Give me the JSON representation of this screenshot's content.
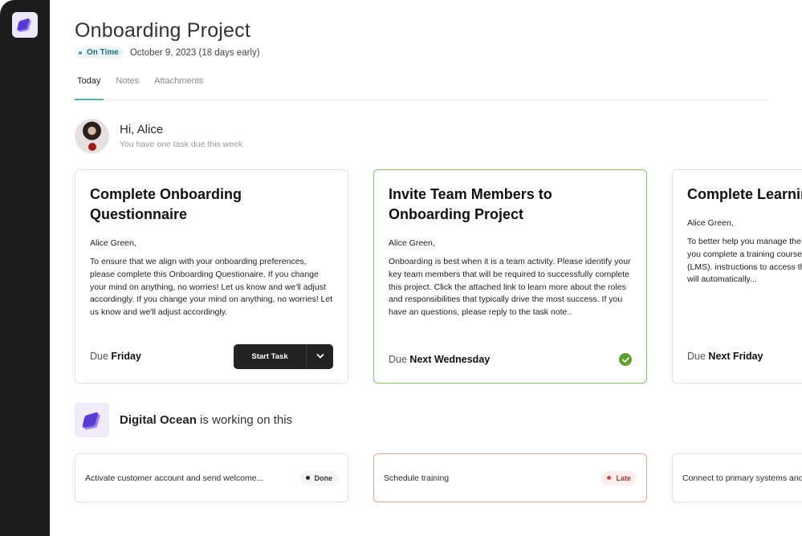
{
  "app": {
    "logo_icon": "layers-icon"
  },
  "header": {
    "title": "Onboarding Project",
    "status": "On Time",
    "due_date": "October 9, 2023 (18 days early)"
  },
  "tabs": [
    {
      "label": "Today",
      "active": true
    },
    {
      "label": "Notes",
      "active": false
    },
    {
      "label": "Attachments",
      "active": false
    }
  ],
  "greeting": {
    "title": "Hi, Alice",
    "subtitle": "You have one task due this week"
  },
  "tasks": [
    {
      "title": "Complete Onboarding Questionnaire",
      "salutation": "Alice Green,",
      "body": "To ensure that we align with your onboarding preferences, please complete this Onboarding Questionaire. If you change your mind on anything, no worries! Let us know and we'll adjust accordingly. If you change your mind on anything, no worries! Let us know and we'll adjust accordingly.",
      "due_prefix": "Due",
      "due_value": "Friday",
      "action_label": "Start Task"
    },
    {
      "title": "Invite Team Members to Onboarding Project",
      "salutation": "Alice Green,",
      "body": "Onboarding is best when it is a team activity. Please identify your key team members that will be required to successfully complete this project. Click the attached link to learn more about the roles and responsibilities that typically drive the most success. If you have an questions, please reply to the task note..",
      "due_prefix": "Due",
      "due_value": "Next Wednesday",
      "completed": true
    },
    {
      "title": "Complete Learning Training",
      "salutation": "Alice Green,",
      "body": "To better help you manage the management, we recommend you complete a training course for the Management System (LMS). instructions to access the training... completed, this task will automatically...",
      "due_prefix": "Due",
      "due_value": "Next Friday"
    }
  ],
  "agency": {
    "name": "Digital Ocean",
    "suffix": "is working on this"
  },
  "agency_tasks": [
    {
      "label": "Activate customer account and send welcome...",
      "status": "Done"
    },
    {
      "label": "Schedule training",
      "status": "Late"
    },
    {
      "label": "Connect to primary systems and...",
      "status": ""
    }
  ],
  "colors": {
    "sidebar": "#1c1c1c",
    "accent_teal": "#5aa8b5",
    "complete_green": "#5f9c31",
    "late_red": "#c74a3c",
    "brand_purple": "#6a4ad6"
  }
}
